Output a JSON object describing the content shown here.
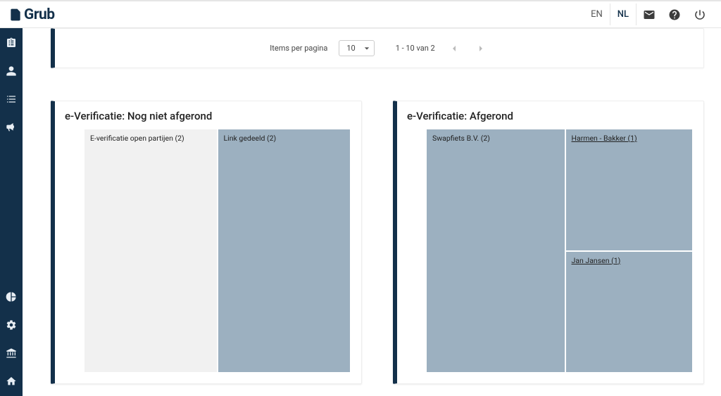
{
  "brand": "Grub",
  "lang": {
    "en": "EN",
    "nl": "NL"
  },
  "pagination": {
    "items_per_page_label": "Items per pagina",
    "page_size": "10",
    "range_text": "1 - 10 van 2"
  },
  "cards": {
    "pending": {
      "title": "e-Verificatie: Nog niet afgerond",
      "tile_open": "E-verificatie open partijen (2)",
      "tile_link": "Link gedeeld (2)"
    },
    "done": {
      "title": "e-Verificatie: Afgerond",
      "tile_company": "Swapfiets B.V. (2)",
      "tile_person1": "Harmen - Bakker (1)",
      "tile_person2": "Jan Jansen (1)"
    }
  },
  "chart_data": [
    {
      "type": "area",
      "title": "e-Verificatie: Nog niet afgerond",
      "series": [
        {
          "name": "E-verificatie open partijen",
          "value": 2
        },
        {
          "name": "Link gedeeld",
          "value": 2
        }
      ]
    },
    {
      "type": "area",
      "title": "e-Verificatie: Afgerond",
      "series": [
        {
          "name": "Swapfiets B.V.",
          "value": 2
        },
        {
          "name": "Harmen - Bakker",
          "value": 1
        },
        {
          "name": "Jan Jansen",
          "value": 1
        }
      ]
    }
  ]
}
